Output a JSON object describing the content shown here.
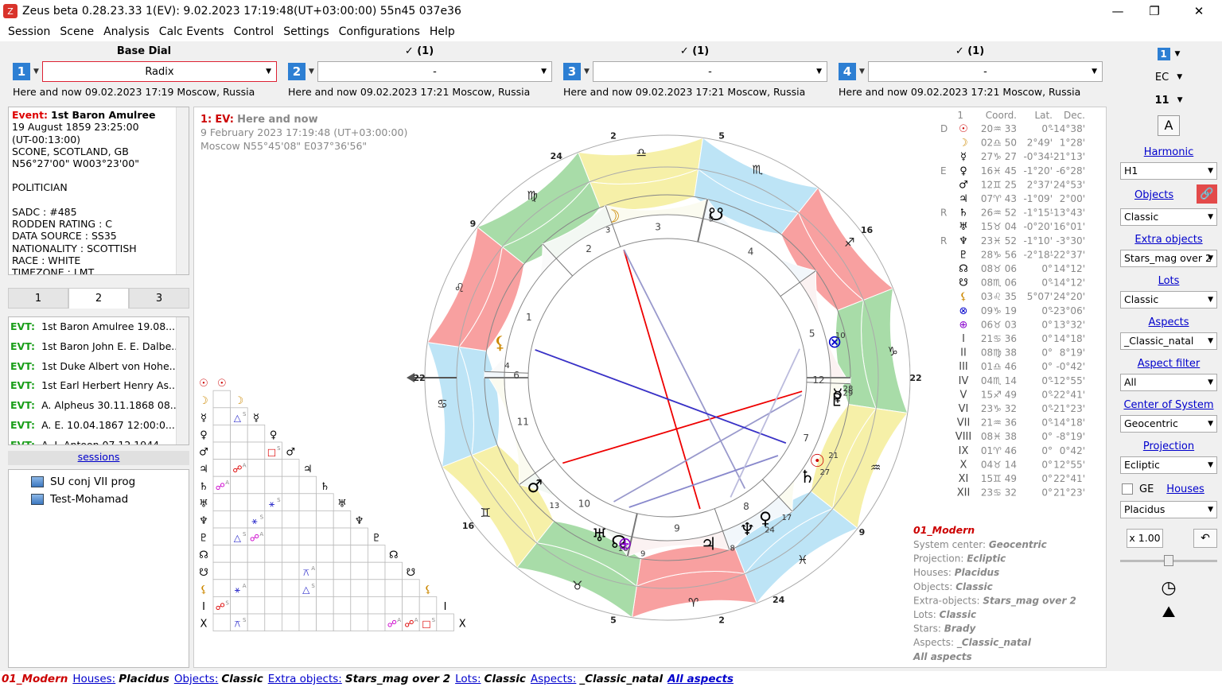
{
  "window": {
    "title": "Zeus beta  0.28.23.33   1(EV): 9.02.2023 17:19:48(UT+03:00:00) 55n45 037e36",
    "icon_glyph": "Z"
  },
  "menu": [
    "Session",
    "Scene",
    "Analysis",
    "Calc Events",
    "Control",
    "Settings",
    "Configurations",
    "Help"
  ],
  "dials": [
    {
      "header": "Base Dial",
      "num": "1",
      "select": "Radix",
      "caption": "Here and now 09.02.2023 17:19 Moscow, Russia"
    },
    {
      "header": "✓ (1)",
      "num": "2",
      "select": "-",
      "caption": "Here and now 09.02.2023 17:21 Moscow, Russia"
    },
    {
      "header": "✓ (1)",
      "num": "3",
      "select": "-",
      "caption": "Here and now 09.02.2023 17:21 Moscow, Russia"
    },
    {
      "header": "✓ (1)",
      "num": "4",
      "select": "-",
      "caption": "Here and now 09.02.2023 17:21 Moscow, Russia"
    }
  ],
  "event": {
    "label": "Event:",
    "name": "1st Baron Amulree",
    "lines": [
      "19 August 1859 23:25:00",
      "(UT-00:13:00)",
      "SCONE, SCOTLAND, GB",
      "N56°27'00\" W003°23'00\"",
      "",
      "POLITICIAN",
      "",
      "SADC : #485",
      "RODDEN RATING : C",
      "DATA SOURCE : SS35",
      "NATIONALITY : SCOTTISH",
      "RACE : WHITE",
      "TIMEZONE : LMT"
    ]
  },
  "tabs": [
    "1",
    "2",
    "3"
  ],
  "events_list": {
    "prefix": "EVT:",
    "items": [
      "1st Baron Amulree 19.08....",
      "1st Baron John E. E. Dalbe...",
      "1st Duke Albert von Hohe...",
      "1st Earl Herbert Henry As...",
      "A. Alpheus 30.11.1868 08...",
      "A. E. 10.04.1867 12:00:0...",
      "A. J. Antoon 07.12.1944"
    ]
  },
  "sessions": {
    "link": "sessions",
    "items": [
      "SU conj VII prog",
      "Test-Mohamad"
    ]
  },
  "chart_header": {
    "num": "1:",
    "ev": "EV:",
    "title": "Here and now",
    "date": "9 February 2023 17:19:48 (UT+03:00:00)",
    "place": "Moscow N55°45'08\" E037°36'56\""
  },
  "positions": {
    "headers": [
      "1",
      "Coord.",
      "Lat.",
      "Dec."
    ],
    "rows": [
      {
        "flag": "D",
        "sym": "☉",
        "coord": "20♒ 33",
        "lat": "0°",
        "dec": "-14°38'",
        "color": "#c00"
      },
      {
        "flag": "",
        "sym": "☽",
        "coord": "02♎ 50",
        "lat": "2°49'",
        "dec": "1°28'",
        "color": "#c80"
      },
      {
        "flag": "",
        "sym": "☿",
        "coord": "27♑ 27",
        "lat": "-0°34'",
        "dec": "-21°13'",
        "color": "#000"
      },
      {
        "flag": "E",
        "sym": "♀",
        "coord": "16♓ 45",
        "lat": "-1°20'",
        "dec": "-6°28'",
        "color": "#000"
      },
      {
        "flag": "",
        "sym": "♂",
        "coord": "12♊ 25",
        "lat": "2°37'",
        "dec": "24°53'",
        "color": "#000"
      },
      {
        "flag": "",
        "sym": "♃",
        "coord": "07♈ 43",
        "lat": "-1°09'",
        "dec": "2°00'",
        "color": "#000"
      },
      {
        "flag": "R",
        "sym": "♄",
        "coord": "26♒ 52",
        "lat": "-1°15'",
        "dec": "-13°43'",
        "color": "#000"
      },
      {
        "flag": "",
        "sym": "♅",
        "coord": "15♉ 04",
        "lat": "-0°20'",
        "dec": "16°01'",
        "color": "#000"
      },
      {
        "flag": "R",
        "sym": "♆",
        "coord": "23♓ 52",
        "lat": "-1°10'",
        "dec": "-3°30'",
        "color": "#000"
      },
      {
        "flag": "",
        "sym": "♇",
        "coord": "28♑ 56",
        "lat": "-2°18'",
        "dec": "-22°37'",
        "color": "#000"
      },
      {
        "flag": "",
        "sym": "☊",
        "coord": "08♉ 06",
        "lat": "0°",
        "dec": "14°12'",
        "color": "#000"
      },
      {
        "flag": "",
        "sym": "☋",
        "coord": "08♏ 06",
        "lat": "0°",
        "dec": "-14°12'",
        "color": "#000"
      },
      {
        "flag": "",
        "sym": "⚸",
        "coord": "03♌ 35",
        "lat": "5°07'",
        "dec": "24°20'",
        "color": "#c80"
      },
      {
        "flag": "",
        "sym": "⊗",
        "coord": "09♑ 19",
        "lat": "0°",
        "dec": "-23°06'",
        "color": "#00c"
      },
      {
        "flag": "",
        "sym": "⊕",
        "coord": "06♉ 03",
        "lat": "0°",
        "dec": "13°32'",
        "color": "#80c"
      },
      {
        "flag": "",
        "sym": "I",
        "coord": "21♋ 36",
        "lat": "0°",
        "dec": "14°18'",
        "color": "#444"
      },
      {
        "flag": "",
        "sym": "II",
        "coord": "08♍ 38",
        "lat": "0°",
        "dec": "8°19'",
        "color": "#444"
      },
      {
        "flag": "",
        "sym": "III",
        "coord": "01♎ 46",
        "lat": "0°",
        "dec": "-0°42'",
        "color": "#444"
      },
      {
        "flag": "",
        "sym": "IV",
        "coord": "04♏ 14",
        "lat": "0°",
        "dec": "-12°55'",
        "color": "#444"
      },
      {
        "flag": "",
        "sym": "V",
        "coord": "15♐ 49",
        "lat": "0°",
        "dec": "-22°41'",
        "color": "#444"
      },
      {
        "flag": "",
        "sym": "VI",
        "coord": "23♑ 32",
        "lat": "0°",
        "dec": "-21°23'",
        "color": "#444"
      },
      {
        "flag": "",
        "sym": "VII",
        "coord": "21♒ 36",
        "lat": "0°",
        "dec": "-14°18'",
        "color": "#444"
      },
      {
        "flag": "",
        "sym": "VIII",
        "coord": "08♓ 38",
        "lat": "0°",
        "dec": "-8°19'",
        "color": "#444"
      },
      {
        "flag": "",
        "sym": "IX",
        "coord": "01♈ 46",
        "lat": "0°",
        "dec": "0°42'",
        "color": "#444"
      },
      {
        "flag": "",
        "sym": "X",
        "coord": "04♉ 14",
        "lat": "0°",
        "dec": "12°55'",
        "color": "#444"
      },
      {
        "flag": "",
        "sym": "XI",
        "coord": "15♊ 49",
        "lat": "0°",
        "dec": "22°41'",
        "color": "#444"
      },
      {
        "flag": "",
        "sym": "XII",
        "coord": "23♋ 32",
        "lat": "0°",
        "dec": "21°23'",
        "color": "#444"
      }
    ]
  },
  "settings_summary": {
    "title": "01_Modern",
    "lines": [
      {
        "k": "System center:",
        "v": "Geocentric"
      },
      {
        "k": "Projection:",
        "v": "Ecliptic"
      },
      {
        "k": "Houses:",
        "v": "Placidus"
      },
      {
        "k": "Objects:",
        "v": "Classic"
      },
      {
        "k": "Extra-objects:",
        "v": "Stars_mag over 2"
      },
      {
        "k": "Lots:",
        "v": "Classic"
      },
      {
        "k": "Stars:",
        "v": "Brady"
      },
      {
        "k": "Aspects:",
        "v": "_Classic_natal"
      },
      {
        "k": "",
        "v": "All aspects"
      }
    ]
  },
  "grid_planets": [
    "☉",
    "☽",
    "☿",
    "♀",
    "♂",
    "♃",
    "♄",
    "♅",
    "♆",
    "♇",
    "☊",
    "☋",
    "⚸",
    "I",
    "X"
  ],
  "grid_cells": [
    {
      "r": 3,
      "c": 2,
      "g": "△",
      "col": "#33c",
      "sub": "S"
    },
    {
      "r": 5,
      "c": 4,
      "g": "□",
      "col": "#d00",
      "sub": "S"
    },
    {
      "r": 6,
      "c": 2,
      "g": "☍",
      "col": "#d00",
      "sub": "A"
    },
    {
      "r": 7,
      "c": 1,
      "g": "☍",
      "col": "#c0c",
      "sub": "A"
    },
    {
      "r": 8,
      "c": 4,
      "g": "⚹",
      "col": "#33c",
      "sub": "S"
    },
    {
      "r": 9,
      "c": 3,
      "g": "⚹",
      "col": "#33c",
      "sub": "S"
    },
    {
      "r": 10,
      "c": 2,
      "g": "△",
      "col": "#33c",
      "sub": "S"
    },
    {
      "r": 10,
      "c": 3,
      "g": "☍",
      "col": "#c0c",
      "sub": "A"
    },
    {
      "r": 12,
      "c": 6,
      "g": "⚻",
      "col": "#33c",
      "sub": "A"
    },
    {
      "r": 13,
      "c": 2,
      "g": "⚹",
      "col": "#33c",
      "sub": "A"
    },
    {
      "r": 13,
      "c": 6,
      "g": "△",
      "col": "#33c",
      "sub": "S"
    },
    {
      "r": 14,
      "c": 1,
      "g": "☍",
      "col": "#d00",
      "sub": "S"
    },
    {
      "r": 15,
      "c": 2,
      "g": "⚻",
      "col": "#33c",
      "sub": "S"
    },
    {
      "r": 15,
      "c": 11,
      "g": "☍",
      "col": "#c0c",
      "sub": "A"
    },
    {
      "r": 15,
      "c": 12,
      "g": "☍",
      "col": "#d00",
      "sub": "A"
    },
    {
      "r": 15,
      "c": 13,
      "g": "□",
      "col": "#d00",
      "sub": "S"
    }
  ],
  "wheel": {
    "signs": [
      {
        "g": "♈",
        "color": "#f8a0a0"
      },
      {
        "g": "♉",
        "color": "#a8dca8"
      },
      {
        "g": "♊",
        "color": "#f6f0a8"
      },
      {
        "g": "♋",
        "color": "#bde4f6"
      },
      {
        "g": "♌",
        "color": "#f8a0a0"
      },
      {
        "g": "♍",
        "color": "#a8dca8"
      },
      {
        "g": "♎",
        "color": "#f6f0a8"
      },
      {
        "g": "♏",
        "color": "#bde4f6"
      },
      {
        "g": "♐",
        "color": "#f8a0a0"
      },
      {
        "g": "♑",
        "color": "#a8dca8"
      },
      {
        "g": "♒",
        "color": "#f6f0a8"
      },
      {
        "g": "♓",
        "color": "#bde4f6"
      }
    ],
    "ascendant_lon": 111.6,
    "angle_labels": [
      {
        "t": "22",
        "lon": 111.6
      },
      {
        "t": "22",
        "lon": 291.6
      },
      {
        "t": "5",
        "lon": 34.2
      },
      {
        "t": "5",
        "lon": 214.2
      },
      {
        "t": "2",
        "lon": 9.0
      },
      {
        "t": "2",
        "lon": 189.0
      },
      {
        "t": "9",
        "lon": 330.0
      },
      {
        "t": "9",
        "lon": 150.0
      },
      {
        "t": "24",
        "lon": 355.0
      },
      {
        "t": "24",
        "lon": 175.0
      },
      {
        "t": "16",
        "lon": 75.0
      },
      {
        "t": "16",
        "lon": 255.0
      }
    ],
    "house_cusps": [
      111.6,
      158.6,
      181.8,
      214.2,
      255.8,
      293.5,
      291.6,
      338.6,
      1.8,
      34.2,
      75.8,
      113.5
    ],
    "house_numbers": [
      "1",
      "2",
      "3",
      "4",
      "5",
      "6",
      "7",
      "8",
      "9",
      "10",
      "11",
      "12"
    ],
    "planets": [
      {
        "g": "☉",
        "lon": 320.5,
        "col": "#c00",
        "deg": "21"
      },
      {
        "g": "☽",
        "lon": 182.8,
        "col": "#c80",
        "deg": "3"
      },
      {
        "g": "☿",
        "lon": 297.4,
        "col": "#000",
        "deg": "28"
      },
      {
        "g": "♀",
        "lon": 346.7,
        "col": "#000",
        "deg": "17"
      },
      {
        "g": "♂",
        "lon": 72.4,
        "col": "#000",
        "deg": "13"
      },
      {
        "g": "♃",
        "lon": 7.7,
        "col": "#000",
        "deg": "8"
      },
      {
        "g": "♄",
        "lon": 326.8,
        "col": "#000",
        "deg": "27"
      },
      {
        "g": "♅",
        "lon": 45.0,
        "col": "#000",
        "deg": "16"
      },
      {
        "g": "♆",
        "lon": 353.8,
        "col": "#000",
        "deg": "24"
      },
      {
        "g": "♇",
        "lon": 298.9,
        "col": "#000",
        "deg": "29"
      },
      {
        "g": "☊",
        "lon": 38.1,
        "col": "#000",
        "deg": "9"
      },
      {
        "g": "☋",
        "lon": 218.1,
        "col": "#000",
        "deg": "9"
      },
      {
        "g": "⚸",
        "lon": 123.5,
        "col": "#c80",
        "deg": "4"
      },
      {
        "g": "⊗",
        "lon": 279.3,
        "col": "#00c",
        "deg": "10"
      },
      {
        "g": "⊕",
        "lon": 36.0,
        "col": "#80c",
        "deg": ""
      }
    ]
  },
  "right_panel": {
    "dial_num": "1",
    "ec": "EC",
    "num11": "11",
    "font_glyph": "A",
    "harmonic": {
      "label": "Harmonic",
      "value": "H1"
    },
    "objects": {
      "label": "Objects",
      "value": "Classic"
    },
    "extra_objects": {
      "label": "Extra objects",
      "value": "Stars_mag over 2"
    },
    "lots": {
      "label": "Lots",
      "value": "Classic"
    },
    "aspects": {
      "label": "Aspects",
      "value": "_Classic_natal"
    },
    "aspect_filter": {
      "label": "Aspect filter",
      "value": "All"
    },
    "center_system": {
      "label": "Center of System",
      "value": "Geocentric"
    },
    "projection": {
      "label": "Projection",
      "value": "Ecliptic"
    },
    "ge_label": "GE",
    "houses": {
      "label": "Houses",
      "value": "Placidus"
    },
    "zoom": "x 1.00",
    "zoom_level": 0.5
  },
  "statusbar": {
    "profile": "01_Modern",
    "items": [
      {
        "k": "Houses:",
        "v": "Placidus"
      },
      {
        "k": "Objects:",
        "v": "Classic"
      },
      {
        "k": "Extra objects:",
        "v": "Stars_mag over 2"
      },
      {
        "k": "Lots:",
        "v": "Classic"
      },
      {
        "k": "Aspects:",
        "v": "_Classic_natal"
      }
    ],
    "all_aspects": "All aspects"
  },
  "colors": {
    "accent": "#2d7fd3",
    "event_red": "#d00000",
    "evt_green": "#1a9e1a",
    "profile_red": "#c00000"
  }
}
